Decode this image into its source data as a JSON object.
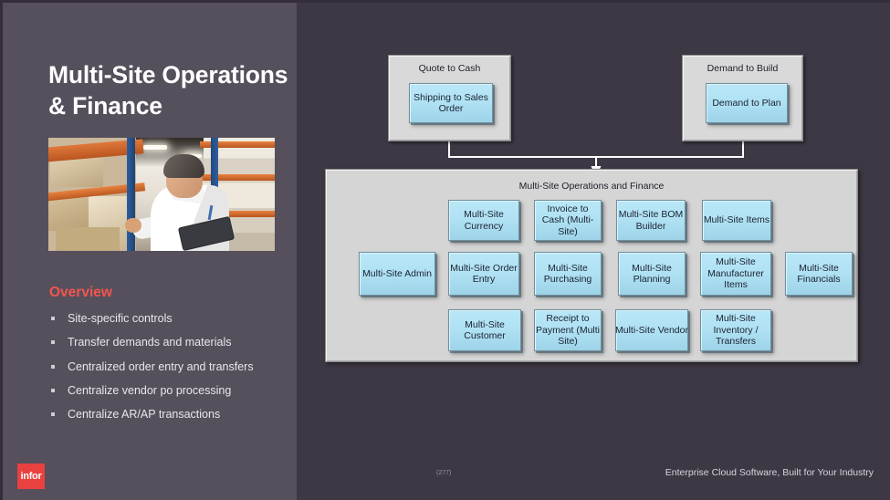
{
  "slide": {
    "title": "Multi-Site Operations\n& Finance",
    "title_line1": "Multi-Site Operations",
    "title_line2": "& Finance",
    "overview_heading": "Overview",
    "bullets": [
      "Site-specific controls",
      "Transfer demands and materials",
      "Centralized order entry and transfers",
      "Centralize vendor po processing",
      "Centralize AR/AP transactions"
    ],
    "image_alt": "warehouse-worker-photo"
  },
  "diagram": {
    "top_groups": [
      {
        "title": "Quote to Cash",
        "node": "Shipping to Sales Order"
      },
      {
        "title": "Demand to Build",
        "node": "Demand to Plan"
      }
    ],
    "panel_title": "Multi-Site Operations and Finance",
    "rows": [
      {
        "nodes": [
          "Multi-Site Currency",
          "Invoice to Cash (Multi-Site)",
          "Multi-Site BOM Builder",
          "Multi-Site Items"
        ]
      },
      {
        "nodes": [
          "Multi-Site Admin",
          "Multi-Site Order Entry",
          "Multi-Site Purchasing",
          "Multi-Site Planning",
          "Multi-Site Manufacturer Items",
          "Multi-Site Financials"
        ]
      },
      {
        "nodes": [
          "Multi-Site Customer",
          "Receipt to Payment (Multi Site)",
          "Multi-Site Vendor",
          "Multi-Site Inventory / Transfers"
        ]
      }
    ]
  },
  "footer": {
    "logo_text": "infor",
    "page_number": "(277)",
    "tagline": "Enterprise Cloud Software, Built for Your Industry"
  },
  "colors": {
    "sidebar_bg": "#564f5c",
    "slide_bg": "#3e3845",
    "accent_red": "#f2554f",
    "logo_red": "#e8413f",
    "node_blue": "#b0e2f4",
    "panel_gray": "#d5d5d5",
    "text_light": "#e9e7ea"
  }
}
